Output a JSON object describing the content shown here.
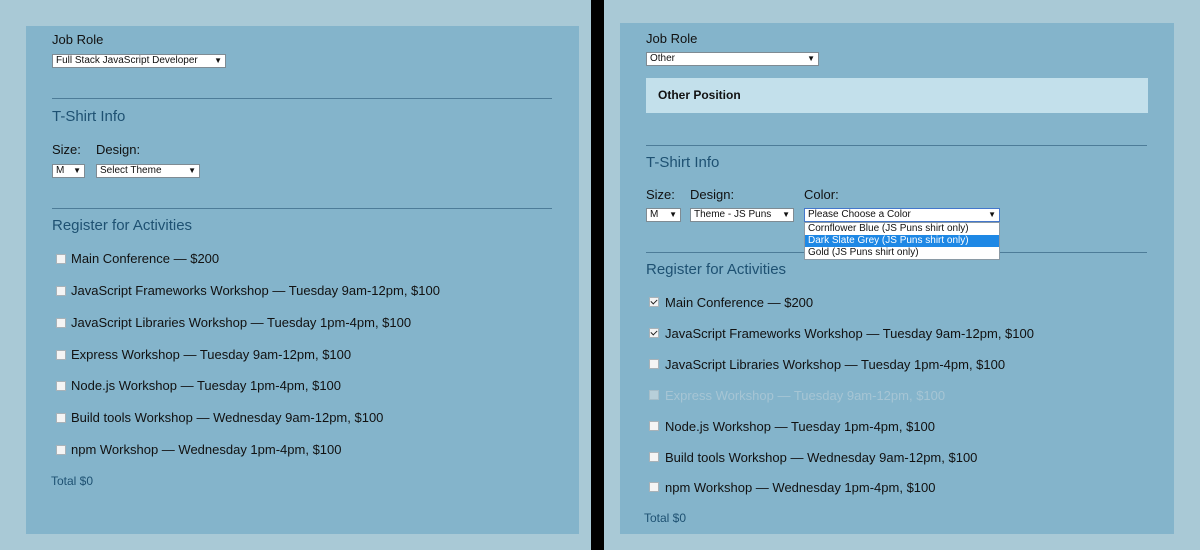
{
  "left": {
    "job_role_label": "Job Role",
    "job_role_value": "Full Stack JavaScript Developer",
    "tshirt_title": "T-Shirt Info",
    "size_label": "Size:",
    "size_value": "M",
    "design_label": "Design:",
    "design_value": "Select Theme",
    "activities_title": "Register for Activities",
    "activities": [
      {
        "label": "Main Conference — $200",
        "checked": false,
        "disabled": false
      },
      {
        "label": "JavaScript Frameworks Workshop — Tuesday 9am-12pm, $100",
        "checked": false,
        "disabled": false
      },
      {
        "label": "JavaScript Libraries Workshop — Tuesday 1pm-4pm, $100",
        "checked": false,
        "disabled": false
      },
      {
        "label": "Express Workshop — Tuesday 9am-12pm, $100",
        "checked": false,
        "disabled": false
      },
      {
        "label": "Node.js Workshop — Tuesday 1pm-4pm, $100",
        "checked": false,
        "disabled": false
      },
      {
        "label": "Build tools Workshop — Wednesday 9am-12pm, $100",
        "checked": false,
        "disabled": false
      },
      {
        "label": "npm Workshop — Wednesday 1pm-4pm, $100",
        "checked": false,
        "disabled": false
      }
    ],
    "total": "Total $0"
  },
  "right": {
    "job_role_label": "Job Role",
    "job_role_value": "Other",
    "other_position": "Other Position",
    "tshirt_title": "T-Shirt Info",
    "size_label": "Size:",
    "size_value": "M",
    "design_label": "Design:",
    "design_value": "Theme - JS Puns",
    "color_label": "Color:",
    "color_value": "Please Choose a Color",
    "color_options": [
      {
        "label": "Cornflower Blue (JS Puns shirt only)",
        "selected": false
      },
      {
        "label": "Dark Slate Grey (JS Puns shirt only)",
        "selected": true
      },
      {
        "label": "Gold (JS Puns shirt only)",
        "selected": false
      }
    ],
    "activities_title": "Register for Activities",
    "activities": [
      {
        "label": "Main Conference — $200",
        "checked": true,
        "disabled": false
      },
      {
        "label": "JavaScript Frameworks Workshop — Tuesday 9am-12pm, $100",
        "checked": true,
        "disabled": false
      },
      {
        "label": "JavaScript Libraries Workshop — Tuesday 1pm-4pm, $100",
        "checked": false,
        "disabled": false
      },
      {
        "label": "Express Workshop — Tuesday 9am-12pm, $100",
        "checked": false,
        "disabled": true
      },
      {
        "label": "Node.js Workshop — Tuesday 1pm-4pm, $100",
        "checked": false,
        "disabled": false
      },
      {
        "label": "Build tools Workshop — Wednesday 9am-12pm, $100",
        "checked": false,
        "disabled": false
      },
      {
        "label": "npm Workshop — Wednesday 1pm-4pm, $100",
        "checked": false,
        "disabled": false
      }
    ],
    "total": "Total $0"
  }
}
